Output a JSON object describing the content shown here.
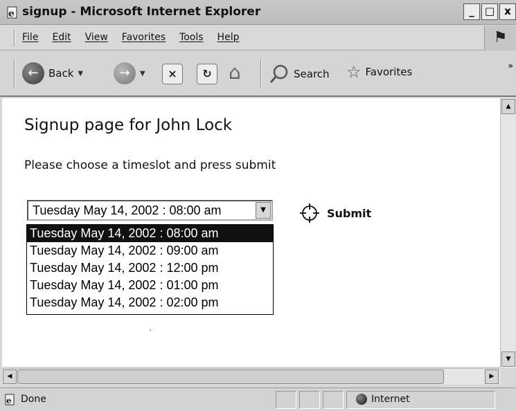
{
  "window": {
    "title": "signup - Microsoft Internet Explorer",
    "minimize": "_",
    "maximize": "□",
    "close": "x"
  },
  "menu": {
    "items": [
      "File",
      "Edit",
      "View",
      "Favorites",
      "Tools",
      "Help"
    ]
  },
  "toolbar": {
    "back_label": "Back",
    "search_label": "Search",
    "favorites_label": "Favorites",
    "overflow": "»"
  },
  "page": {
    "title": "Signup page for John Lock",
    "instructions": "Please choose a timeslot and press submit",
    "select": {
      "value": "Tuesday May 14, 2002 : 08:00 am",
      "options": [
        "Tuesday May 14, 2002 : 08:00 am",
        "Tuesday May 14, 2002 : 09:00 am",
        "Tuesday May 14, 2002 : 12:00 pm",
        "Tuesday May 14, 2002 : 01:00 pm",
        "Tuesday May 14, 2002 : 02:00 pm"
      ],
      "highlighted_index": 0
    },
    "submit_label": "Submit"
  },
  "status": {
    "text": "Done",
    "zone": "Internet"
  },
  "icons": {
    "app": "ie-page-icon",
    "back": "back-arrow-icon",
    "forward": "forward-arrow-icon",
    "stop": "stop-icon",
    "refresh": "refresh-icon",
    "home": "home-icon",
    "search": "search-icon",
    "favorites": "favorites-star-icon",
    "submit": "crosshair-target-icon"
  }
}
